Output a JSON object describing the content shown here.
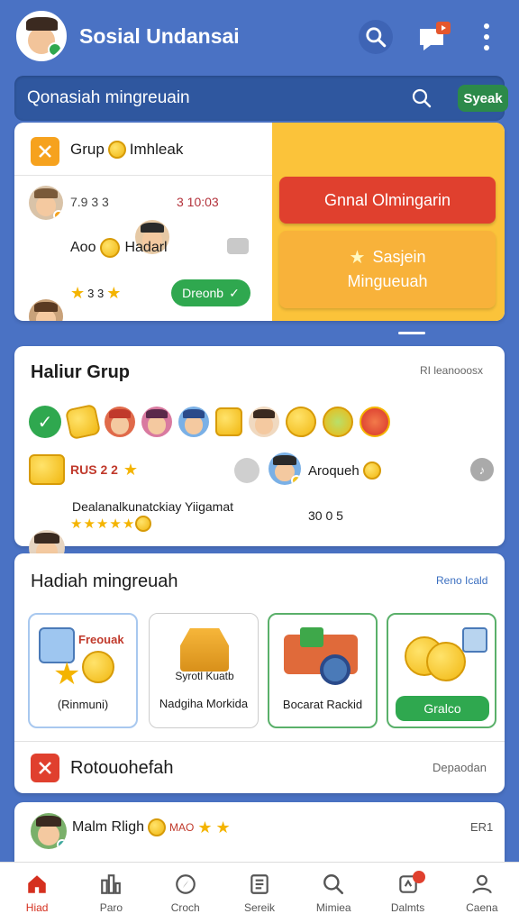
{
  "header": {
    "title": "Sosial Undansai",
    "notify_count": ""
  },
  "search": {
    "placeholder": "Qonasiah mingreuain",
    "button_label": "Syeak"
  },
  "group_card": {
    "title": "Grup",
    "title_suffix": "Imhleak",
    "rows": [
      {
        "left_text": "7.9 3 3",
        "right_text": "3 10:03"
      },
      {
        "left_text": "Aoo",
        "right_text": "Hadarl"
      },
      {
        "left_text": "3 3",
        "button": "Dreonb"
      }
    ]
  },
  "promo": {
    "primary_button": "Gnnal Olmingarin",
    "secondary_line1": "Sasjein",
    "secondary_line2": "Mingueuah"
  },
  "haliur": {
    "title": "Haliur Grup",
    "meta": "RI leanooosx",
    "row2_text": "RUS 2 2",
    "row2_right_text": "Aroqueh",
    "row3_text": "Dealanalkunatckiay Yiigamat",
    "row3_right_text": "30 0 5"
  },
  "rewards": {
    "title": "Hadiah mingreuah",
    "link": "Reno Icald",
    "items": [
      {
        "top_text": "Freouak",
        "bottom_text": "(Rinmuni)"
      },
      {
        "top_text": "Syrotl Kuatb",
        "bottom_text": "Nadgiha Morkida"
      },
      {
        "top_text": "",
        "bottom_text": "Bocarat Rackid"
      },
      {
        "top_text": "",
        "bottom_text": "",
        "button": "Gralco"
      }
    ]
  },
  "protect": {
    "label": "Rotouohefah",
    "right": "Depaodan"
  },
  "last_row": {
    "name": "Malm Rligh",
    "suffix": "MAO",
    "right": "ER1"
  },
  "bottom_nav": [
    {
      "label": "Hiad",
      "icon": "home-icon",
      "active": true
    },
    {
      "label": "Paro",
      "icon": "chart-icon",
      "active": false
    },
    {
      "label": "Croch",
      "icon": "compass-icon",
      "active": false
    },
    {
      "label": "Sereik",
      "icon": "list-icon",
      "active": false
    },
    {
      "label": "Mimiea",
      "icon": "search-icon",
      "active": false
    },
    {
      "label": "Dalmts",
      "icon": "bell-icon",
      "active": false
    },
    {
      "label": "Caena",
      "icon": "profile-icon",
      "active": false
    }
  ],
  "colors": {
    "background": "#4a72c4",
    "accent_green": "#2fa84f",
    "accent_red": "#e0402e",
    "accent_yellow": "#fbc33a",
    "nav_active": "#d5301f"
  }
}
